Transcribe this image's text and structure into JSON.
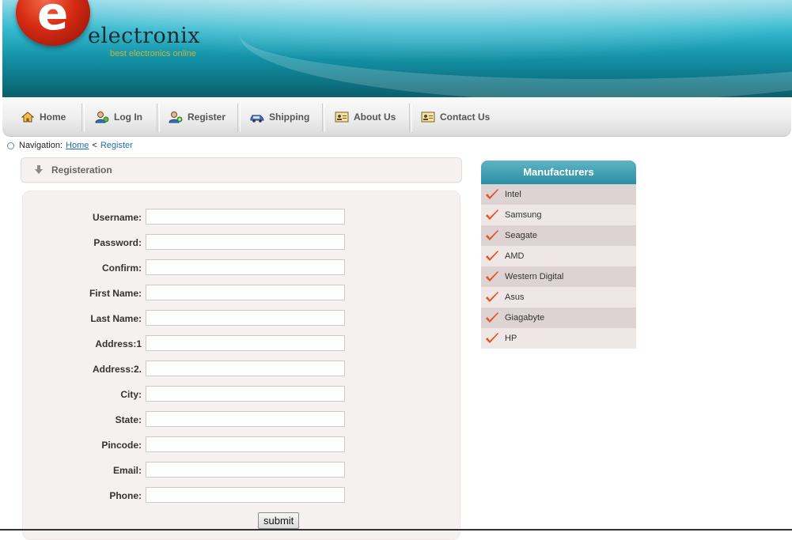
{
  "brand": {
    "letter": "e",
    "name": "electronix",
    "tagline": "best electronics online"
  },
  "nav": [
    {
      "label": "Home",
      "icon": "home-icon"
    },
    {
      "label": "Log In",
      "icon": "login-user-icon"
    },
    {
      "label": "Register",
      "icon": "register-user-icon"
    },
    {
      "label": "Shipping",
      "icon": "car-icon"
    },
    {
      "label": "About Us",
      "icon": "id-card-icon"
    },
    {
      "label": "Contact Us",
      "icon": "id-card-icon"
    }
  ],
  "breadcrumb": {
    "prefix": "Navigation:",
    "home": "Home",
    "separator": "<",
    "current": "Register"
  },
  "panel": {
    "title": "Registeration"
  },
  "form": {
    "fields": [
      {
        "label": "Username:",
        "value": ""
      },
      {
        "label": "Password:",
        "value": ""
      },
      {
        "label": "Confirm:",
        "value": ""
      },
      {
        "label": "First Name:",
        "value": ""
      },
      {
        "label": "Last Name:",
        "value": ""
      },
      {
        "label": "Address:1",
        "value": ""
      },
      {
        "label": "Address:2.",
        "value": ""
      },
      {
        "label": "City:",
        "value": ""
      },
      {
        "label": "State:",
        "value": ""
      },
      {
        "label": "Pincode:",
        "value": ""
      },
      {
        "label": "Email:",
        "value": ""
      },
      {
        "label": "Phone:",
        "value": ""
      }
    ],
    "submit_label": "submit"
  },
  "manufacturers": {
    "title": "Manufacturers",
    "items": [
      "Intel",
      "Samsung",
      "Seagate",
      "AMD",
      "Western Digital",
      "Asus",
      "Giagabyte",
      "HP"
    ]
  },
  "colors": {
    "accent_teal": "#2a8fa3",
    "link_blue": "#1a6fb3",
    "logo_red": "#d62b14",
    "check_red": "#e8501f"
  }
}
